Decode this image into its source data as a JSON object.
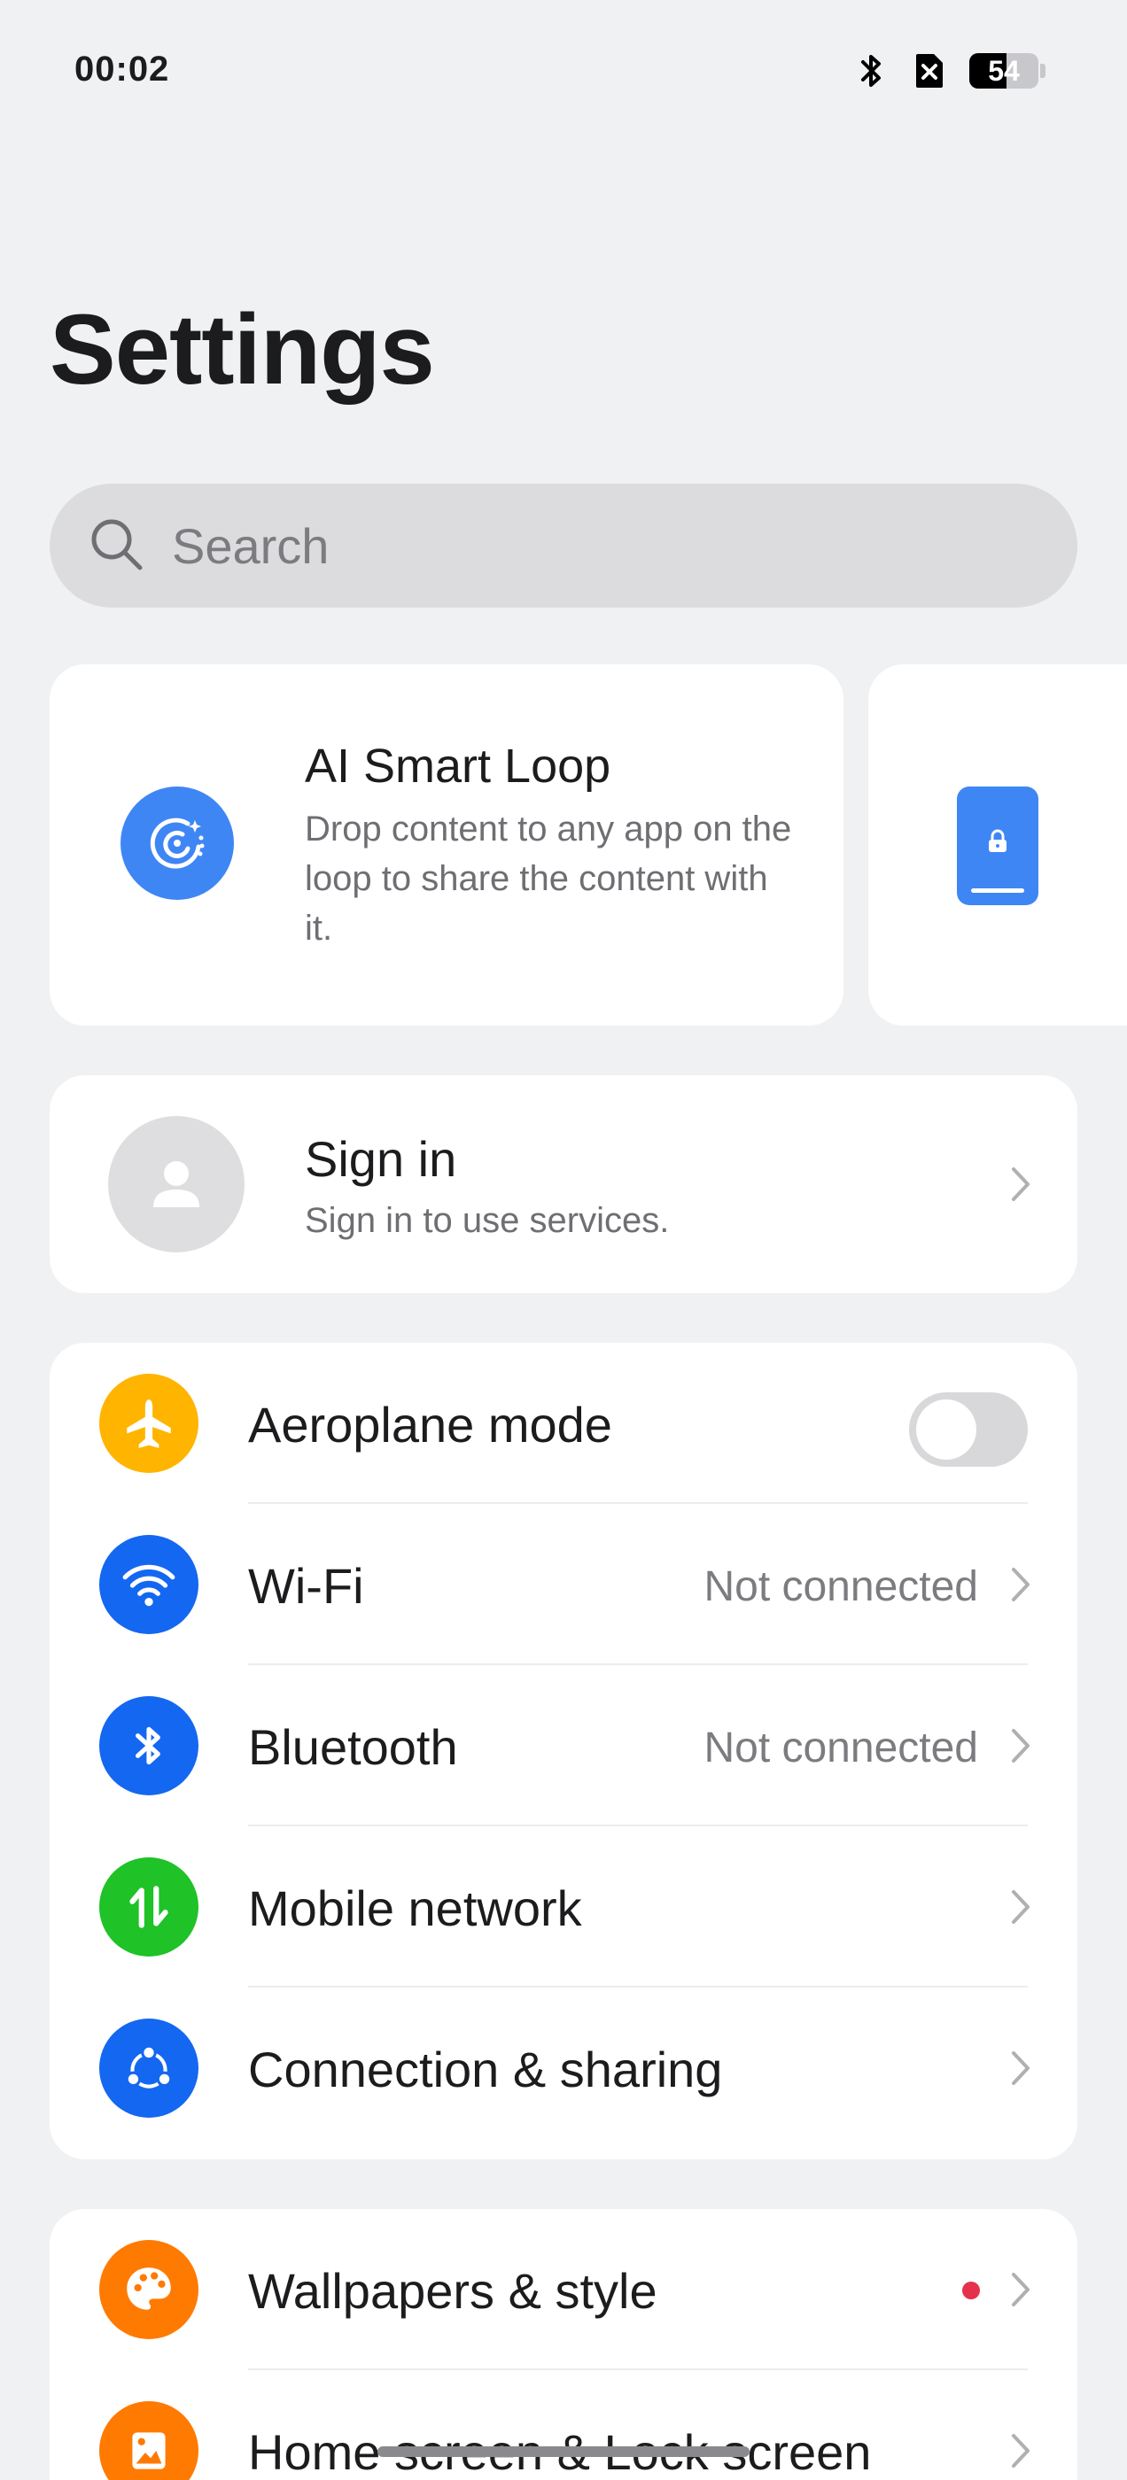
{
  "status": {
    "time": "00:02",
    "battery": "54",
    "battery_level": 0.54
  },
  "title": "Settings",
  "search": {
    "placeholder": "Search"
  },
  "feature_cards": [
    {
      "title": "AI Smart Loop",
      "description": "Drop content to any app on the loop to share the content with it.",
      "icon": "smart-loop-icon"
    },
    {
      "icon": "lock-screen-icon"
    }
  ],
  "signin": {
    "title": "Sign in",
    "subtitle": "Sign in to use services."
  },
  "connect_group": [
    {
      "label": "Aeroplane mode",
      "icon": "airplane-icon",
      "color": "#ffb400",
      "toggle": false
    },
    {
      "label": "Wi-Fi",
      "value": "Not connected",
      "icon": "wifi-icon",
      "color": "#1467f0"
    },
    {
      "label": "Bluetooth",
      "value": "Not connected",
      "icon": "bluetooth-icon",
      "color": "#1467f0"
    },
    {
      "label": "Mobile network",
      "icon": "mobile-network-icon",
      "color": "#1fc227"
    },
    {
      "label": "Connection & sharing",
      "icon": "connection-sharing-icon",
      "color": "#1467f0"
    }
  ],
  "display_group": [
    {
      "label": "Wallpapers & style",
      "icon": "palette-icon",
      "color": "#ff7a00",
      "badge": true
    },
    {
      "label": "Home screen & Lock screen",
      "icon": "home-screen-icon",
      "color": "#ff7a00"
    }
  ]
}
